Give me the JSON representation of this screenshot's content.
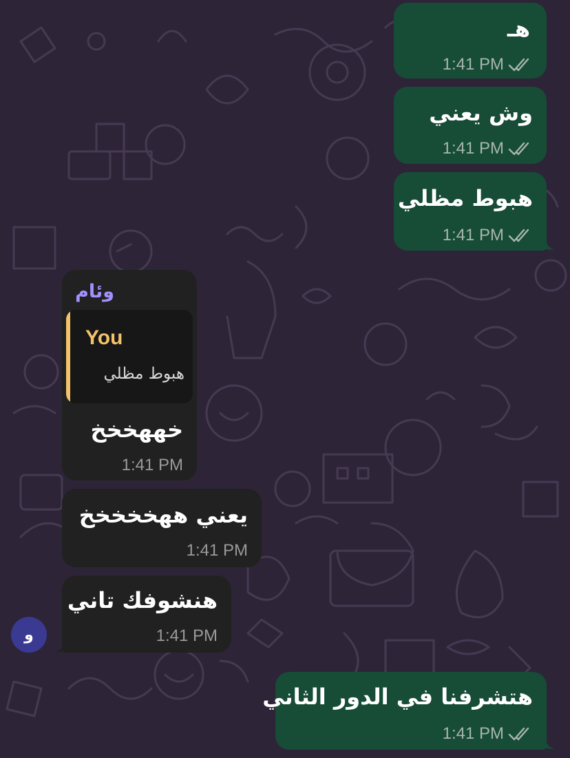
{
  "colors": {
    "background": "#2e2438",
    "outgoing_bubble": "#174c37",
    "incoming_bubble": "#212121",
    "sender_name": "#a390ff",
    "reply_accent": "#f3c26b",
    "avatar": "#3b3a92"
  },
  "messages": [
    {
      "direction": "outgoing",
      "text": "هـ",
      "time": "1:41 PM",
      "status_icon": "double-check-icon"
    },
    {
      "direction": "outgoing",
      "text": "وش يعني",
      "time": "1:41 PM",
      "status_icon": "double-check-icon"
    },
    {
      "direction": "outgoing",
      "text": "هبوط مظلي",
      "time": "1:41 PM",
      "status_icon": "double-check-icon"
    },
    {
      "direction": "incoming",
      "sender": "وئام",
      "reply": {
        "author": "You",
        "text": "هبوط مظلي"
      },
      "text": "خههخخخ",
      "time": "1:41 PM"
    },
    {
      "direction": "incoming",
      "text": "يعني ههخخخخخ",
      "time": "1:41 PM"
    },
    {
      "direction": "incoming",
      "text": "هنشوفك تاني",
      "time": "1:41 PM"
    },
    {
      "direction": "outgoing",
      "text": "هتشرفنا في الدور الثاني",
      "time": "1:41 PM",
      "status_icon": "double-check-icon"
    }
  ],
  "avatar": {
    "initial": "و",
    "icon": "contact-avatar"
  }
}
